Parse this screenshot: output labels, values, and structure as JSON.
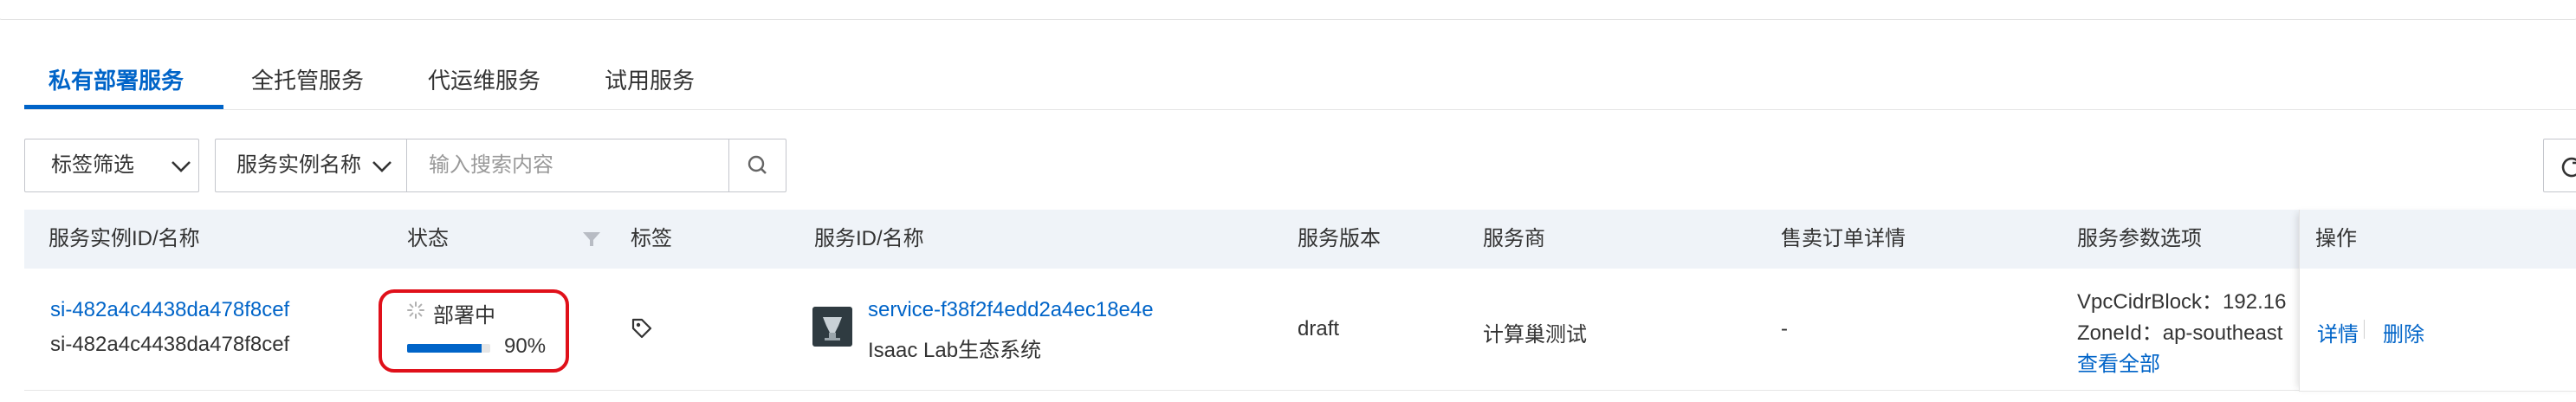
{
  "tabs": [
    {
      "label": "私有部署服务",
      "active": true
    },
    {
      "label": "全托管服务",
      "active": false
    },
    {
      "label": "代运维服务",
      "active": false
    },
    {
      "label": "试用服务",
      "active": false
    }
  ],
  "toolbar": {
    "tag_filter_label": "标签筛选",
    "search_field_select": "服务实例名称",
    "search_placeholder": "输入搜索内容",
    "search_value": ""
  },
  "table": {
    "columns": [
      "服务实例ID/名称",
      "状态",
      "标签",
      "服务ID/名称",
      "服务版本",
      "服务商",
      "售卖订单详情",
      "服务参数选项",
      "操作"
    ],
    "rows": [
      {
        "instance_id": "si-482a4c4438da478f8cef",
        "instance_name": "si-482a4c4438da478f8cef",
        "status": "部署中",
        "progress": 0.9,
        "progress_text": "90%",
        "service_id": "service-f38f2f4edd2a4ec18e4e",
        "service_name": "Isaac Lab生态系统",
        "version": "draft",
        "provider": "计算巢测试",
        "order_detail": "-",
        "params": [
          "VpcCidrBlock：192.16",
          "ZoneId：ap-southeast"
        ],
        "view_all": "查看全部",
        "actions": {
          "detail": "详情",
          "delete": "删除"
        }
      }
    ]
  },
  "colors": {
    "accent": "#0064c8",
    "highlight": "#e0101a",
    "header_bg": "#eff3f8"
  },
  "icons": [
    "chevron-down-icon",
    "search-icon",
    "refresh-icon",
    "filter-icon",
    "tag-icon",
    "loading-spinner-icon",
    "service-logo-icon"
  ]
}
